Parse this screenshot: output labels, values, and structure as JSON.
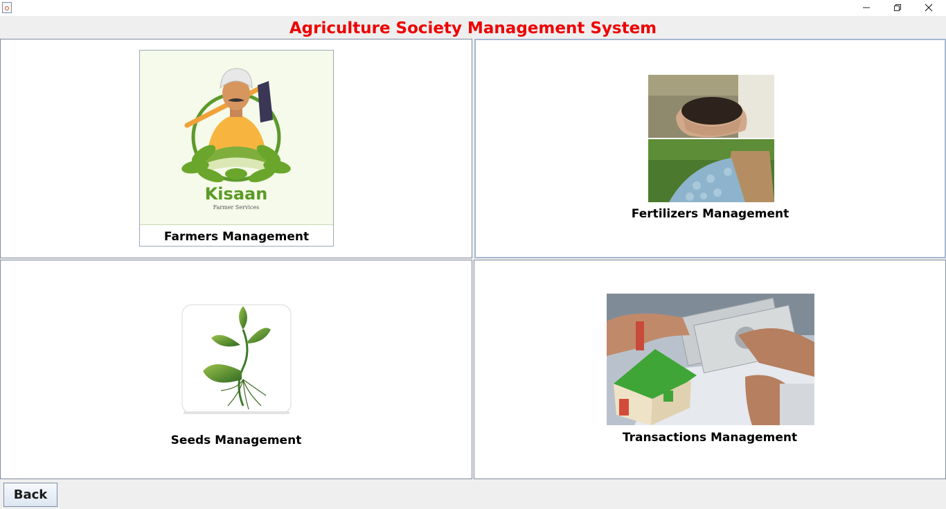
{
  "window": {
    "minimize_glyph": "—",
    "maximize_glyph": "❐",
    "close_glyph": "✕"
  },
  "app": {
    "title": "Agriculture Society Management System",
    "title_color": "#ee0000"
  },
  "cards": {
    "farmers": {
      "label": "Farmers Management",
      "logo_text": "Kisaan",
      "logo_subtext": "Farmer Services",
      "image_icon": "farmer-logo-image"
    },
    "fertilizers": {
      "label": "Fertilizers Management",
      "image_icon": "fertilizer-photo"
    },
    "seeds": {
      "label": "Seeds Management",
      "image_icon": "seedling-icon"
    },
    "transactions": {
      "label": "Transactions Management",
      "image_icon": "money-house-photo"
    }
  },
  "footer": {
    "back_label": "Back"
  }
}
